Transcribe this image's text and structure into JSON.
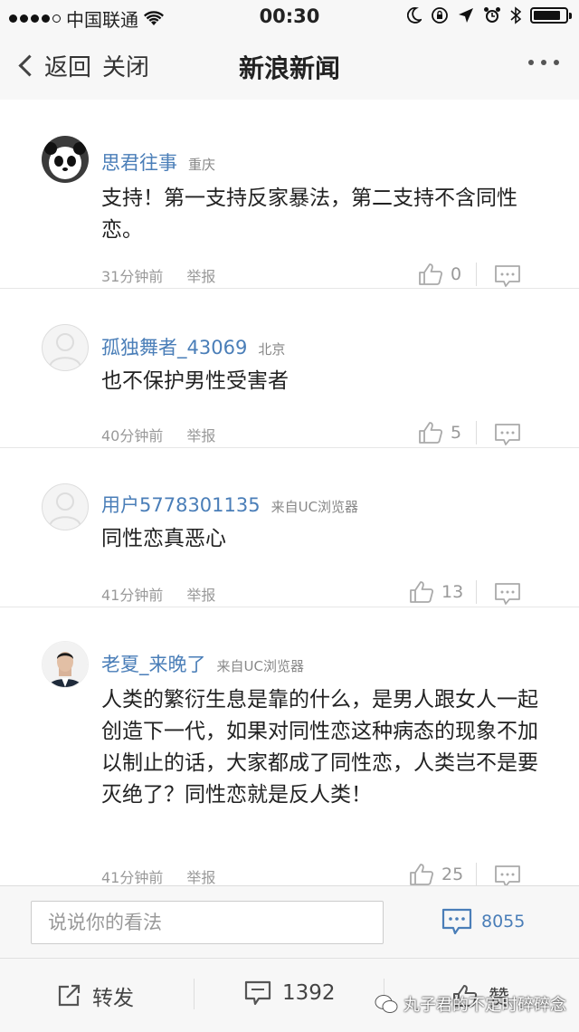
{
  "status_bar": {
    "carrier": "中国联通",
    "time": "00:30",
    "battery_level": 0.85,
    "icons": [
      "signal-dots",
      "wifi-icon",
      "moon-icon",
      "rotation-lock-icon",
      "location-icon",
      "alarm-icon",
      "bluetooth-icon",
      "battery-icon"
    ]
  },
  "nav": {
    "back_label": "返回",
    "close_label": "关闭",
    "title": "新浪新闻"
  },
  "comments": [
    {
      "user": "思君往事",
      "location": "重庆",
      "text": "支持！第一支持反家暴法，第二支持不含同性恋。",
      "time": "31分钟前",
      "report_label": "举报",
      "likes": "0",
      "avatar": "panda"
    },
    {
      "user": "孤独舞者_43069",
      "location": "北京",
      "text": "也不保护男性受害者",
      "time": "40分钟前",
      "report_label": "举报",
      "likes": "5",
      "avatar": "default"
    },
    {
      "user": "用户5778301135",
      "location": "来自UC浏览器",
      "text": "同性恋真恶心",
      "time": "41分钟前",
      "report_label": "举报",
      "likes": "13",
      "avatar": "default"
    },
    {
      "user": "老夏_来晚了",
      "location": "来自UC浏览器",
      "text": "人类的繁衍生息是靠的什么，是男人跟女人一起创造下一代，如果对同性恋这种病态的现象不加以制止的话，大家都成了同性恋，人类岂不是要灭绝了？同性恋就是反人类！",
      "time": "41分钟前",
      "report_label": "举报",
      "likes": "25",
      "avatar": "photo"
    }
  ],
  "comment_input": {
    "placeholder": "说说你的看法",
    "comment_count": "8055"
  },
  "tab_bar": {
    "share_label": "转发",
    "comments_count": "1392",
    "like_label": "赞"
  },
  "watermark": "丸子君的不定时碎碎念",
  "colors": {
    "link_blue": "#4a7eb8",
    "meta_gray": "#999999",
    "background": "#f7f7f7"
  }
}
